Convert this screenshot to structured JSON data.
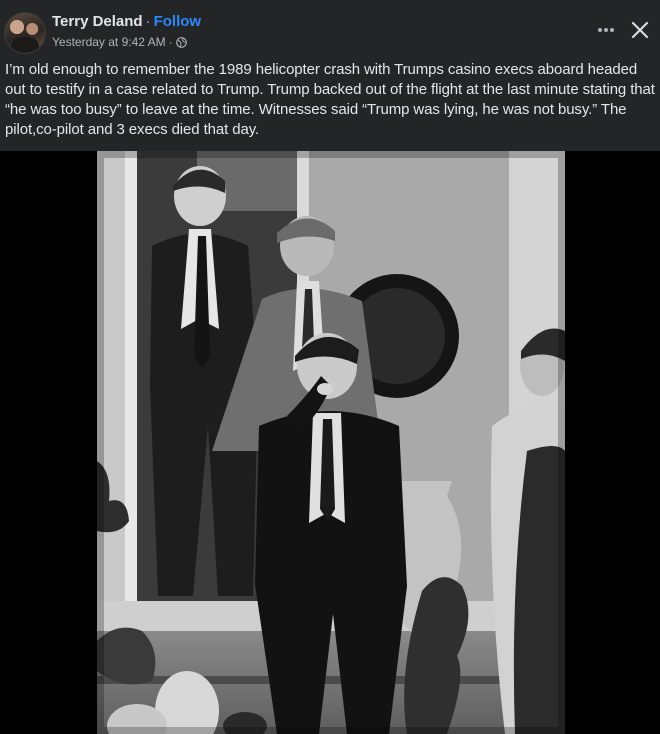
{
  "author": {
    "name": "Terry Deland",
    "separator": "·",
    "follow_label": "Follow"
  },
  "meta": {
    "timestamp": "Yesterday at 9:42 AM",
    "separator": "·",
    "audience_icon": "globe-icon"
  },
  "actions": {
    "more_icon": "more-horizontal-icon",
    "close_icon": "close-icon"
  },
  "post": {
    "text": "I’m old enough to remember the 1989  helicopter crash with Trumps  casino execs aboard headed out to testify in a case related to Trump. Trump backed out of the flight at the last minute stating that “he was too busy” to leave at the time. Witnesses said “Trump was lying, he was not busy.” The pilot,co-pilot and 3 execs died that day."
  },
  "colors": {
    "background": "#242526",
    "link": "#2d88ff",
    "secondary_text": "#b0b3b8",
    "primary_text": "#e4e6eb"
  }
}
